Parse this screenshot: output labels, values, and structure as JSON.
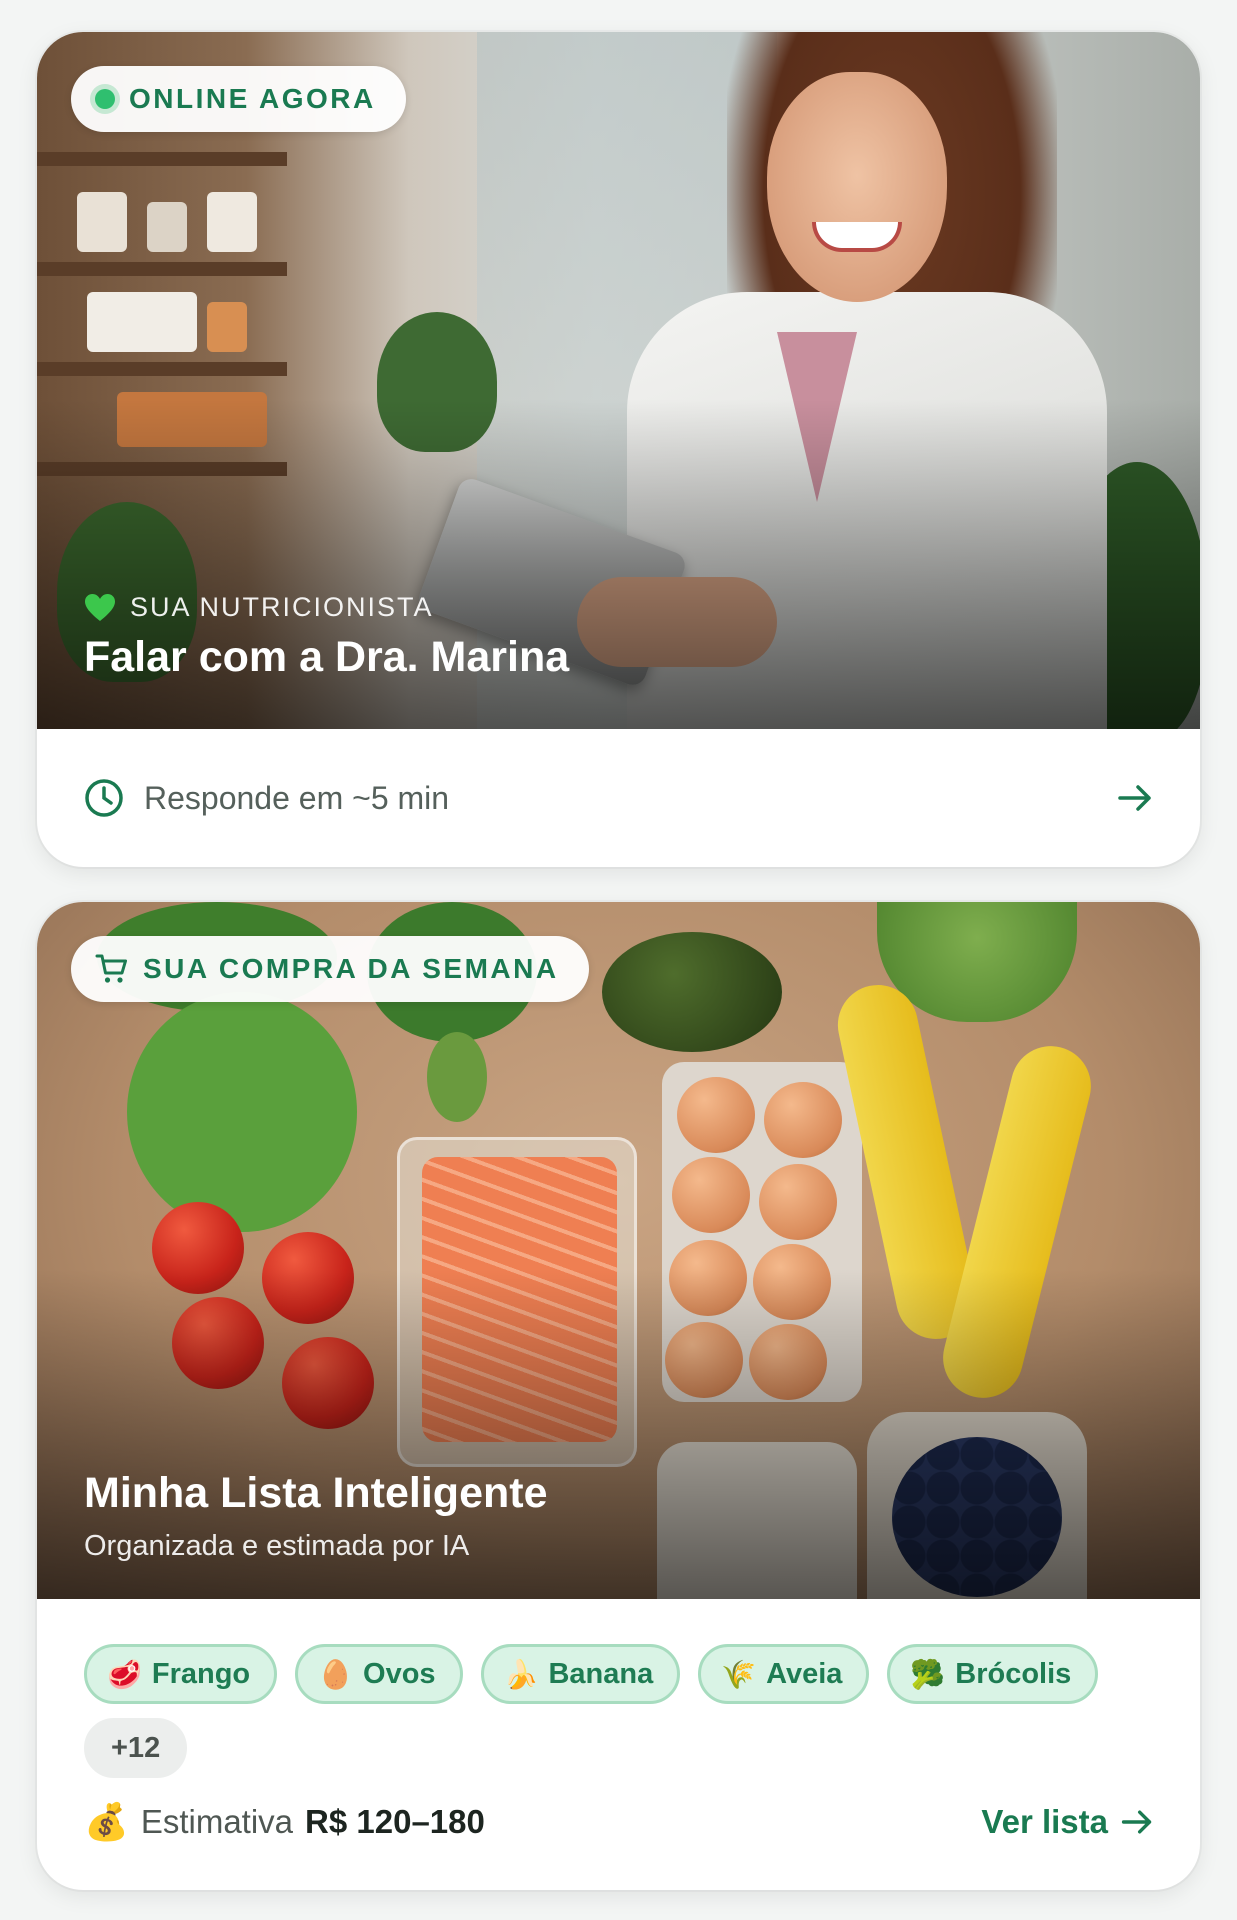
{
  "nutritionist_card": {
    "status_badge": "ONLINE AGORA",
    "kicker": "SUA NUTRICIONISTA",
    "title": "Falar com a Dra. Marina",
    "response_time": "Responde em ~5 min",
    "status_color": "#2fbf6f"
  },
  "shopping_card": {
    "badge": "SUA COMPRA DA SEMANA",
    "title": "Minha Lista Inteligente",
    "subtitle": "Organizada e estimada por IA",
    "items": [
      {
        "emoji": "🥩",
        "label": "Frango"
      },
      {
        "emoji": "🥚",
        "label": "Ovos"
      },
      {
        "emoji": "🍌",
        "label": "Banana"
      },
      {
        "emoji": "🌾",
        "label": "Aveia"
      },
      {
        "emoji": "🥦",
        "label": "Brócolis"
      }
    ],
    "more_count": "+12",
    "estimate_label": "Estimativa",
    "estimate_value": "R$ 120–180",
    "see_list": "Ver lista",
    "moneybag_emoji": "💰"
  },
  "colors": {
    "accent": "#1a7a51",
    "chip_bg": "#d9f3e5"
  }
}
